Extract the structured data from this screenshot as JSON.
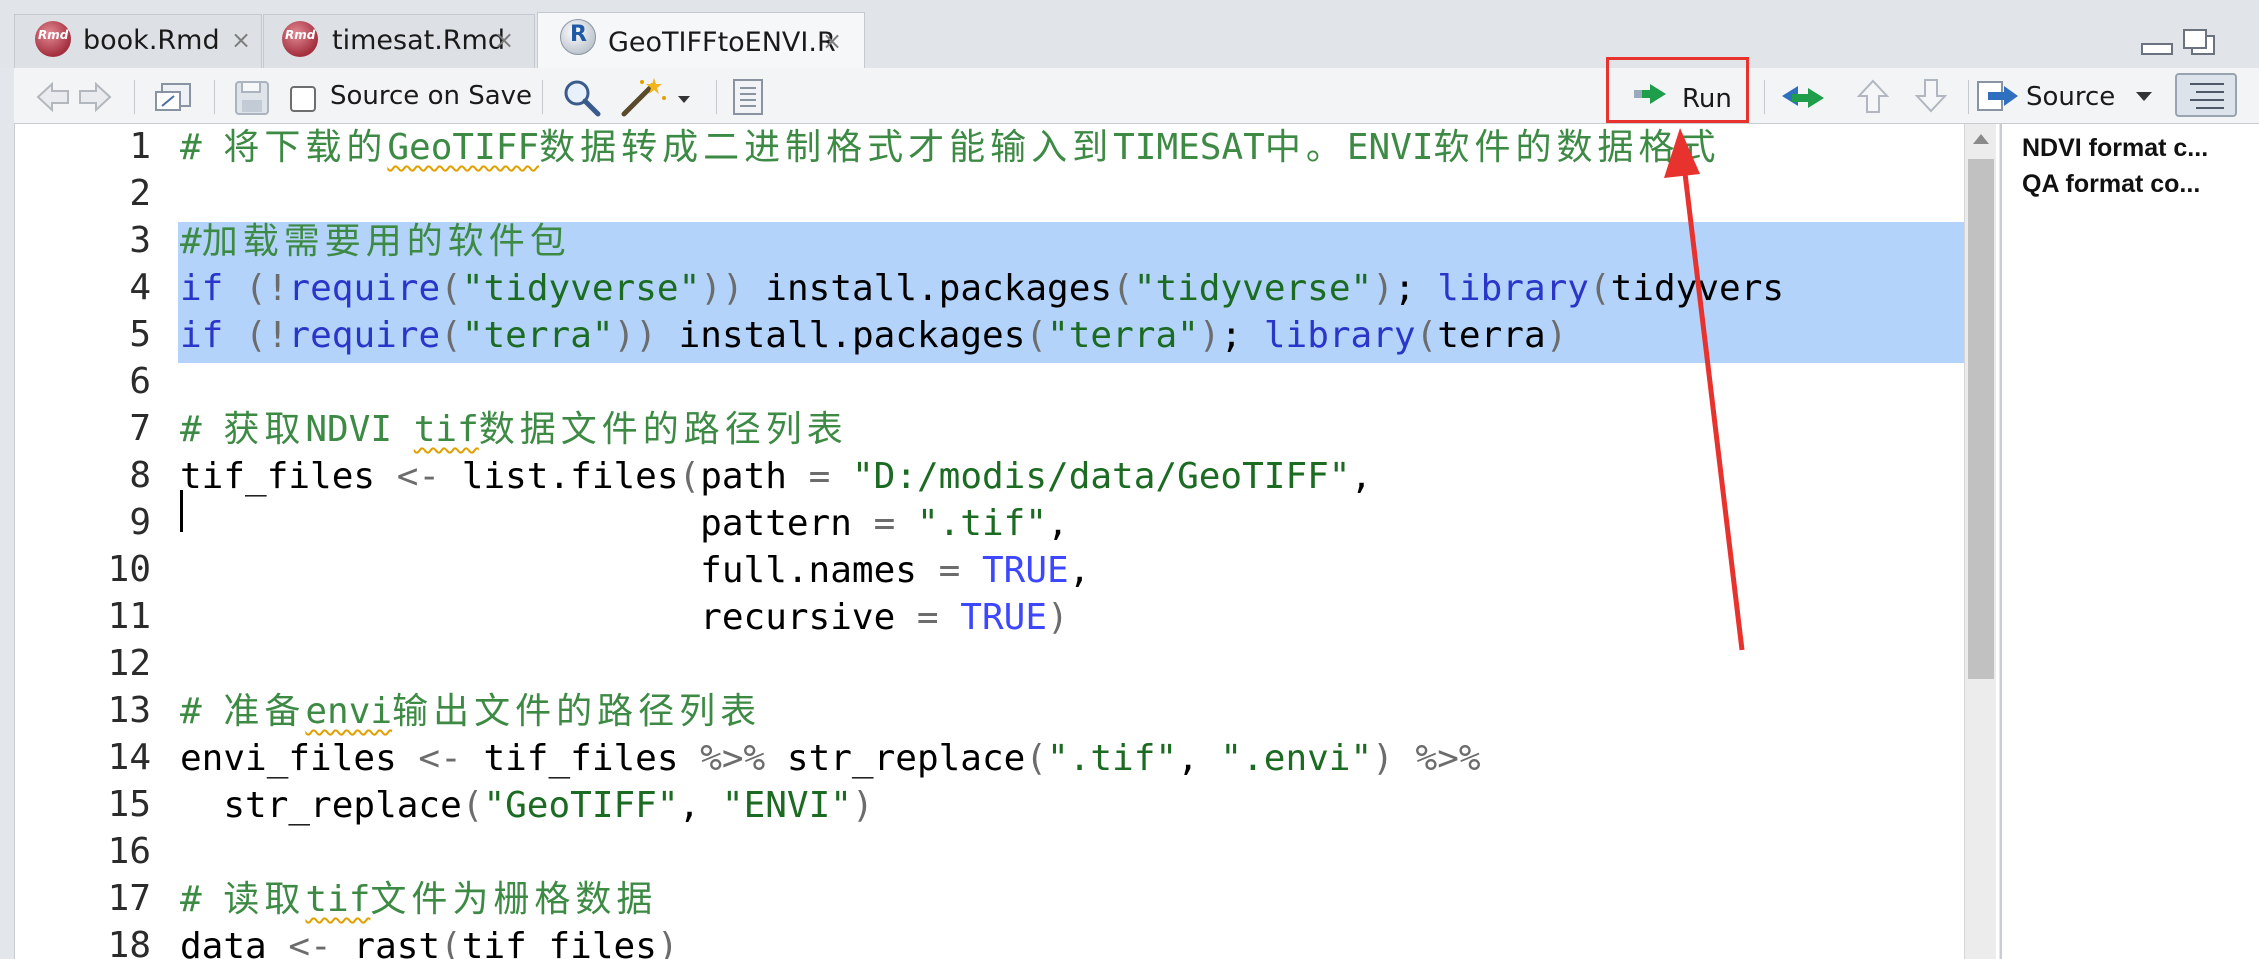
{
  "tabs": [
    {
      "label": "book.Rmd",
      "icon": "rmd-file-icon",
      "icon_text": "Rmd"
    },
    {
      "label": "timesat.Rmd",
      "icon": "rmd-file-icon",
      "icon_text": "Rmd"
    },
    {
      "label": "GeoTIFFtoENVI.R",
      "icon": "r-file-icon",
      "icon_text": "R",
      "active": true
    }
  ],
  "tab_close_glyph": "×",
  "toolbar": {
    "source_on_save_label": "Source on Save",
    "source_on_save_checked": false,
    "run_label": "Run",
    "source_label": "Source"
  },
  "editor": {
    "line_numbers": [
      "1",
      "2",
      "3",
      "4",
      "5",
      "6",
      "7",
      "8",
      "9",
      "10",
      "11",
      "12",
      "13",
      "14",
      "15",
      "16",
      "17",
      "18"
    ],
    "lines": [
      "# 将下载的GeoTIFF数据转成二进制格式才能输入到TIMESAT中。ENVI软件的数据格式",
      "",
      "#加载需要用的软件包",
      "if (!require(\"tidyverse\")) install.packages(\"tidyverse\"); library(tidyvers",
      "if (!require(\"terra\")) install.packages(\"terra\"); library(terra)",
      "",
      "# 获取NDVI tif数据文件的路径列表",
      "tif_files <- list.files(path = \"D:/modis/data/GeoTIFF\",",
      "                        pattern = \".tif\",",
      "                        full.names = TRUE,",
      "                        recursive = TRUE)",
      "",
      "# 准备envi输出文件的路径列表",
      "envi_files <- tif_files %>% str_replace(\".tif\", \".envi\") %>%",
      "  str_replace(\"GeoTIFF\", \"ENVI\")",
      "",
      "# 读取tif文件为栅格数据",
      "data <- rast(tif_files)"
    ]
  },
  "outline": {
    "items": [
      "NDVI format c...",
      "QA format co..."
    ]
  },
  "colors": {
    "selection": "#b3d3fb",
    "comment": "#3d8a45",
    "string": "#1b6b22",
    "keyword": "#2a36c8",
    "constant": "#3c47ff",
    "annotation_red": "#e8322e",
    "run_arrow_green": "#1e9e4a"
  }
}
